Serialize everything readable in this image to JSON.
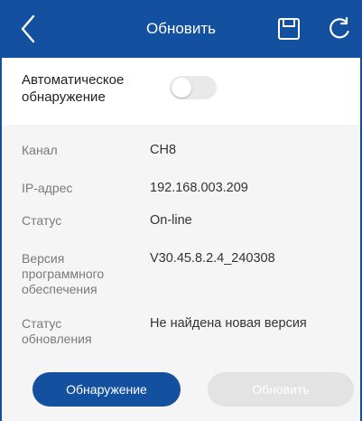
{
  "header": {
    "title": "Обновить",
    "back_icon": "chevron-left-icon",
    "save_icon": "save-icon",
    "refresh_icon": "refresh-icon"
  },
  "auto_detect": {
    "label": "Автоматическое обнаружение",
    "enabled": false
  },
  "info": {
    "channel_label": "Канал",
    "channel_value": "CH8",
    "ip_label": "IP-адрес",
    "ip_value": "192.168.003.209",
    "status_label": "Статус",
    "status_value": "On-line",
    "version_label": "Версия программного обеспечения",
    "version_value": "V30.45.8.2.4_240308",
    "update_status_label": "Статус обновления",
    "update_status_value": "Не найдена новая версия"
  },
  "buttons": {
    "detect_label": "Обнаружение",
    "update_label": "Обновить"
  },
  "colors": {
    "accent": "#1450a0",
    "disabled_button": "#e3e3e3"
  }
}
